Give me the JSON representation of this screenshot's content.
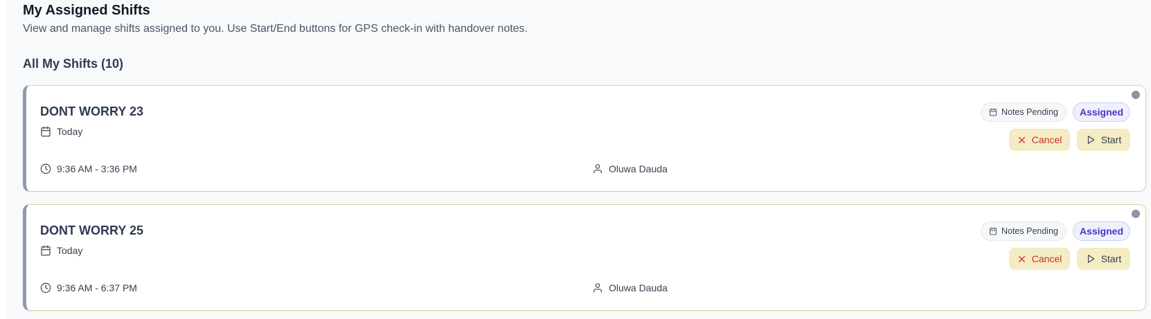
{
  "header": {
    "title": "My Assigned Shifts",
    "subtitle": "View and manage shifts assigned to you. Use Start/End buttons for GPS check-in with handover notes.",
    "section_title": "All My Shifts (10)"
  },
  "shifts": [
    {
      "name": "DONT WORRY 23",
      "date": "Today",
      "time": "9:36 AM - 3:36 PM",
      "person": "Oluwa Dauda",
      "notes_badge": "Notes Pending",
      "status": "Assigned",
      "cancel_label": "Cancel",
      "start_label": "Start"
    },
    {
      "name": "DONT WORRY 25",
      "date": "Today",
      "time": "9:36 AM - 6:37 PM",
      "person": "Oluwa Dauda",
      "notes_badge": "Notes Pending",
      "status": "Assigned",
      "cancel_label": "Cancel",
      "start_label": "Start"
    }
  ],
  "icons": {
    "date": "calendar-icon",
    "time": "clock-icon",
    "person": "user-icon",
    "notes": "calendar-icon",
    "cancel": "x-icon",
    "start": "play-icon"
  },
  "colors": {
    "accent": "#4c33c9",
    "danger": "#d12c2c",
    "button_bg": "#f3ecc4",
    "card_border": "#d9d4a4",
    "card_left_border": "#9099b2"
  }
}
